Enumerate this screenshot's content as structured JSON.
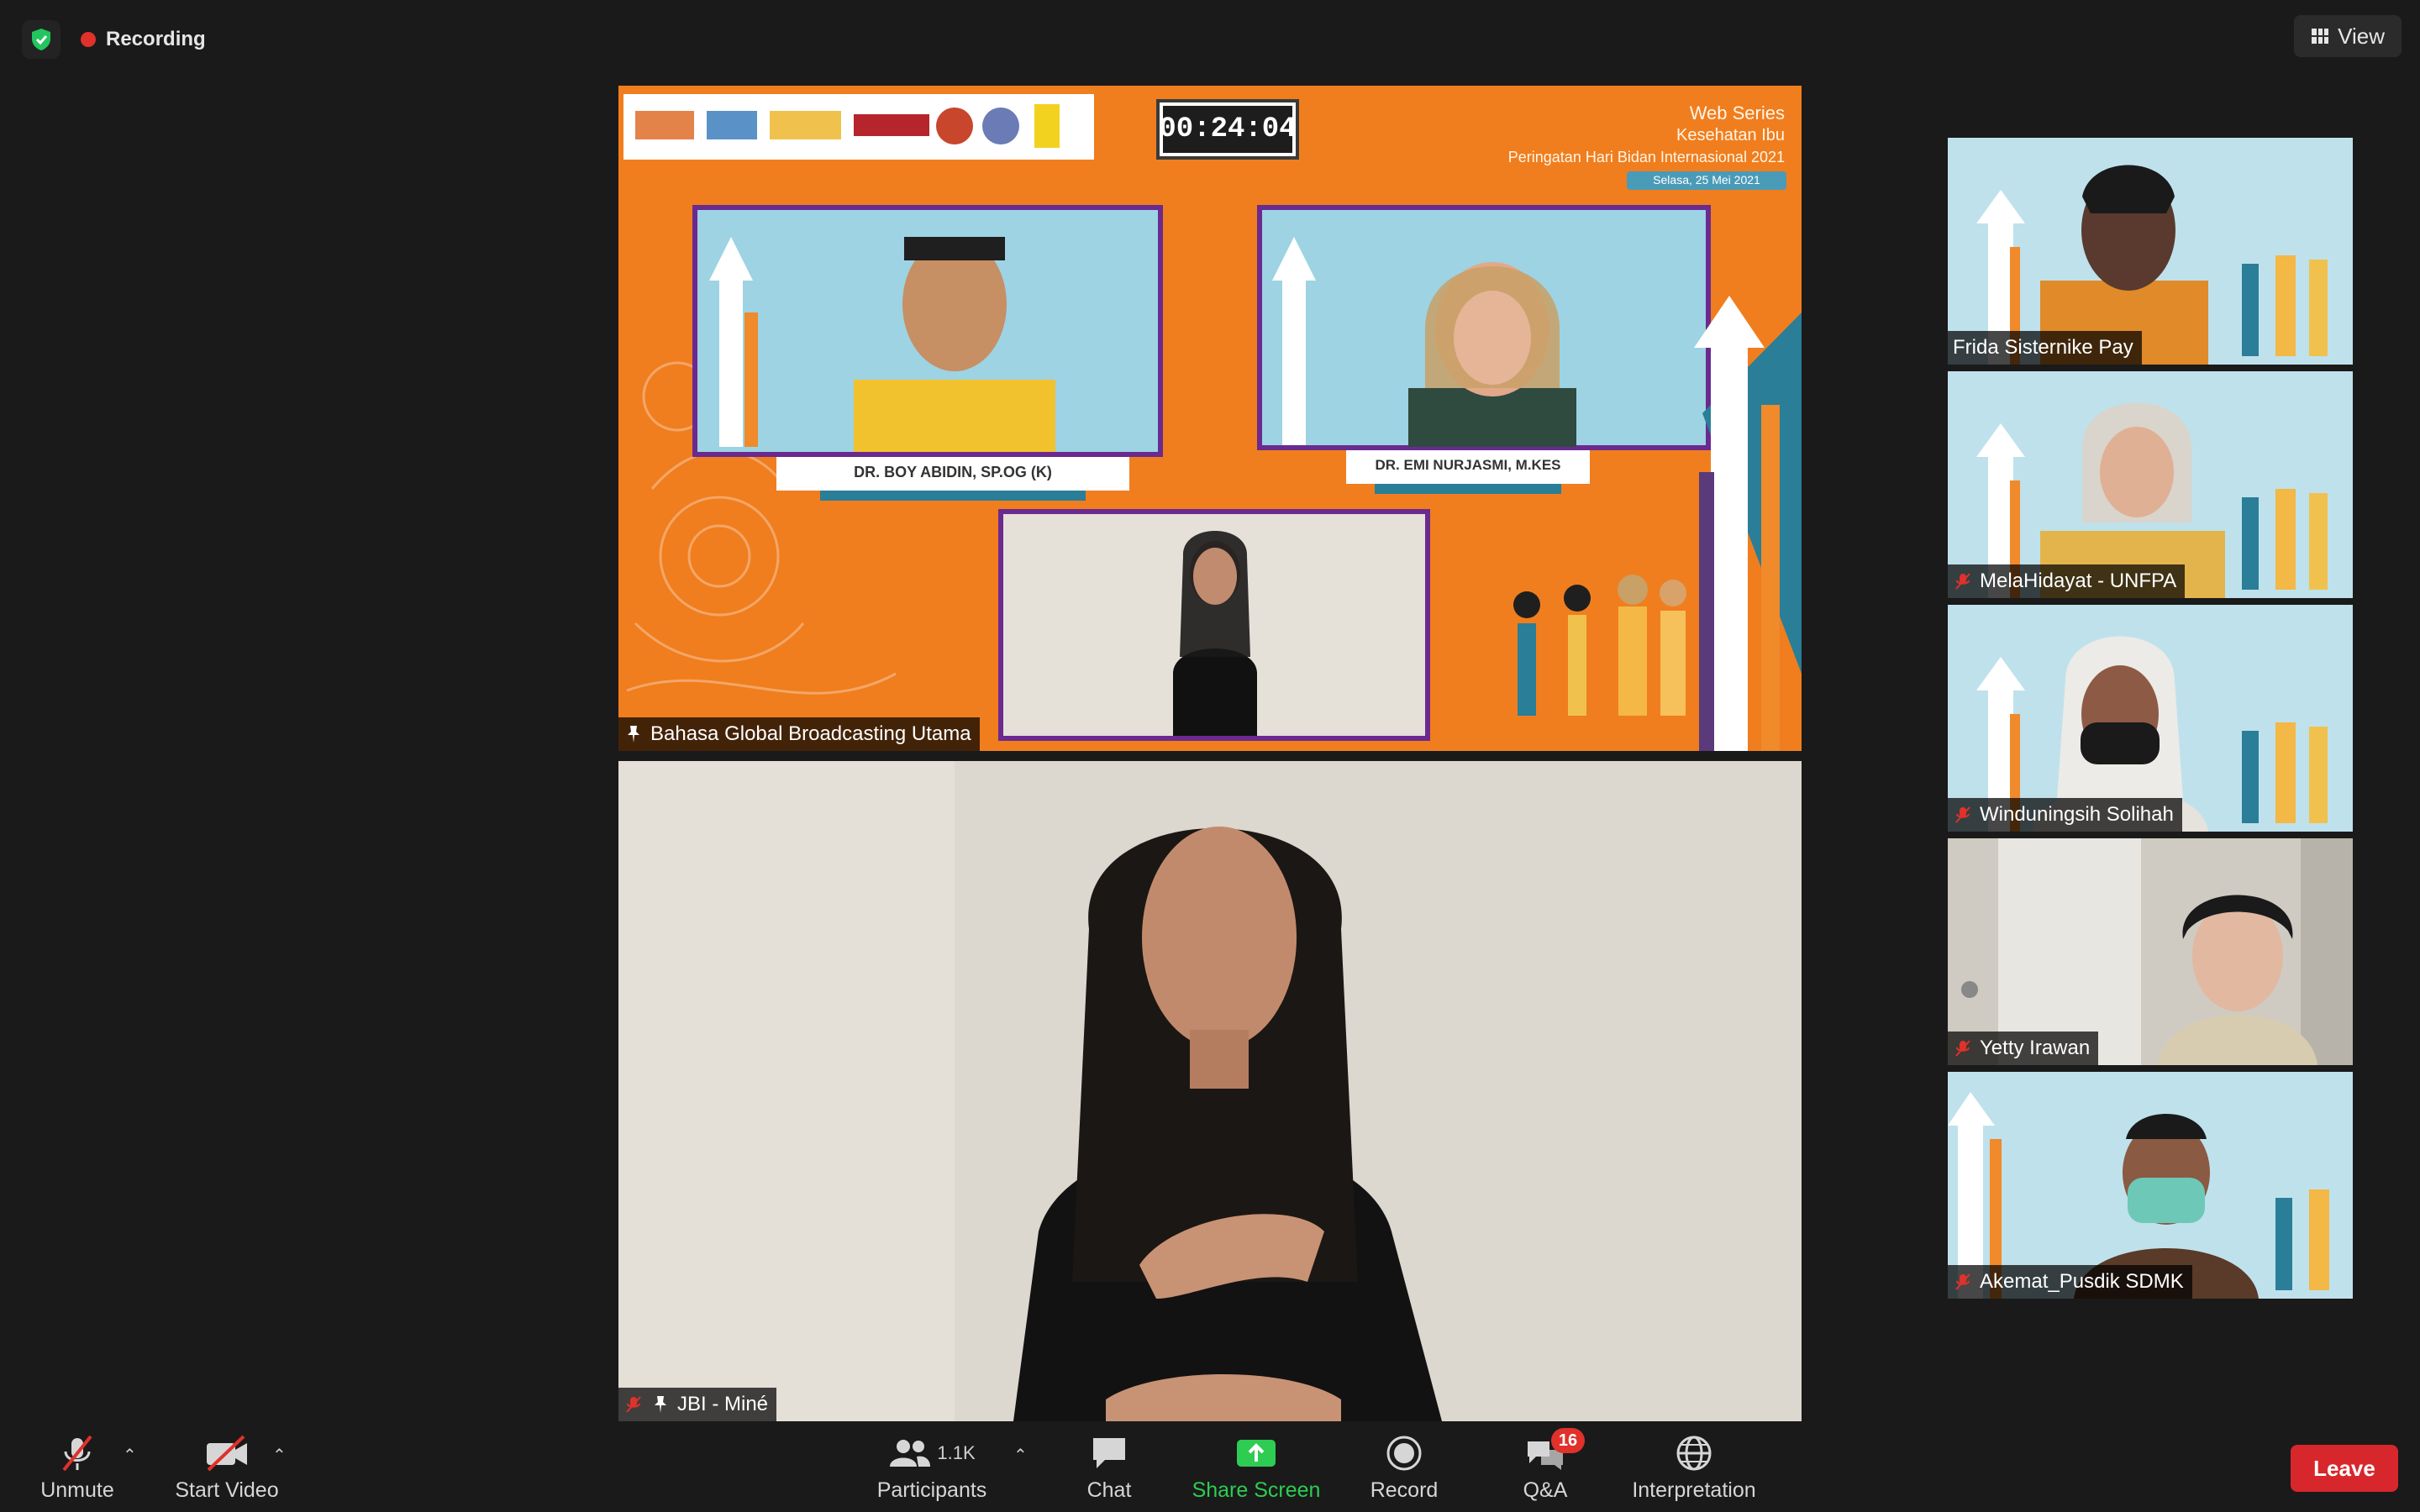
{
  "top_bar": {
    "recording_label": "Recording",
    "view_label": "View",
    "colors": {
      "recording_dot": "#e0312b",
      "shield": "#22c55e"
    }
  },
  "main_share": {
    "timer": "00:24:04",
    "event_title": "Web Series",
    "event_subtitle_1": "Kesehatan Ibu",
    "event_subtitle_2": "Peringatan Hari Bidan Internasional 2021",
    "event_date": "Selasa, 25 Mei 2021",
    "speaker_1_caption": "DR. BOY ABIDIN, SP.OG (K)",
    "speaker_2_caption": "DR. EMI NURJASMI, M.KES",
    "participant_name": "Bahasa Global Broadcasting Utama",
    "colors": {
      "background": "#f07e1e",
      "panel": "#6ec0d6"
    }
  },
  "pinned_video": {
    "participant_name": "JBI - Miné"
  },
  "gallery": [
    {
      "name": "Frida Sisternike Pay",
      "muted": false
    },
    {
      "name": "MelaHidayat - UNFPA",
      "muted": true
    },
    {
      "name": "Winduningsih Solihah",
      "muted": true
    },
    {
      "name": "Yetty Irawan",
      "muted": true
    },
    {
      "name": "Akemat_Pusdik SDMK",
      "muted": true
    }
  ],
  "toolbar": {
    "unmute_label": "Unmute",
    "start_video_label": "Start Video",
    "participants_label": "Participants",
    "participants_count": "1.1K",
    "chat_label": "Chat",
    "share_screen_label": "Share Screen",
    "record_label": "Record",
    "qa_label": "Q&A",
    "qa_badge": "16",
    "interpretation_label": "Interpretation",
    "leave_label": "Leave",
    "colors": {
      "share": "#2ecc52",
      "leave": "#d7272c"
    }
  }
}
